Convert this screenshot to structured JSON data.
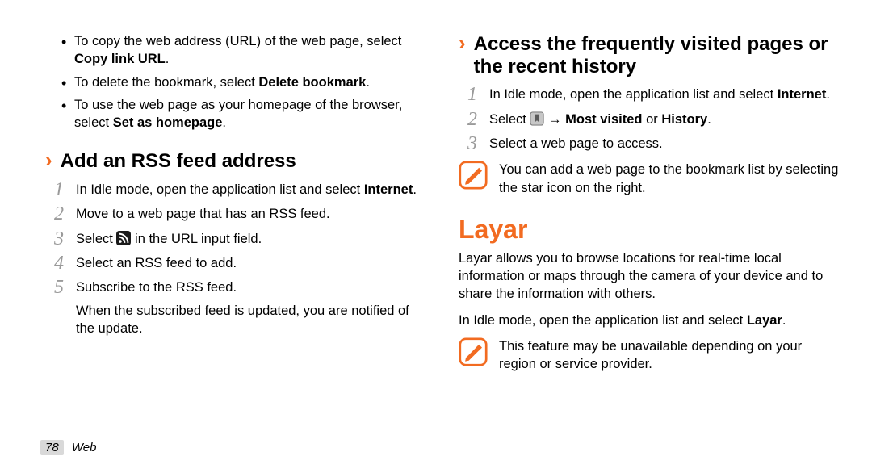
{
  "left": {
    "bullets": [
      {
        "pre": "To copy the web address (URL) of the web page, select ",
        "bold": "Copy link URL",
        "post": "."
      },
      {
        "pre": "To delete the bookmark, select ",
        "bold": "Delete bookmark",
        "post": "."
      },
      {
        "pre": "To use the web page as your homepage of the browser, select ",
        "bold": "Set as homepage",
        "post": "."
      }
    ],
    "section_title": "Add an RSS feed address",
    "steps": {
      "s1": {
        "num": "1",
        "pre": "In Idle mode, open the application list and select ",
        "bold": "Internet",
        "post": "."
      },
      "s2": {
        "num": "2",
        "pre": "Move to a web page that has an RSS feed.",
        "bold": "",
        "post": ""
      },
      "s3": {
        "num": "3",
        "pre": "Select ",
        "post": " in the URL input field."
      },
      "s4": {
        "num": "4",
        "pre": "Select an RSS feed to add.",
        "bold": "",
        "post": ""
      },
      "s5": {
        "num": "5",
        "pre": "Subscribe to the RSS feed.",
        "bold": "",
        "post": ""
      },
      "s5_extra": "When the subscribed feed is updated, you are notified of the update."
    }
  },
  "right": {
    "section_title": "Access the frequently visited pages or the recent history",
    "steps": {
      "s1": {
        "num": "1",
        "pre": "In Idle mode, open the application list and select ",
        "bold": "Internet",
        "post": "."
      },
      "s2": {
        "num": "2",
        "pre": "Select ",
        "mid": " → ",
        "bold": "Most visited",
        "mid2": " or ",
        "bold2": "History",
        "post": "."
      },
      "s3": {
        "num": "3",
        "pre": "Select a web page to access.",
        "bold": "",
        "post": ""
      }
    },
    "note1": "You can add a web page to the bookmark list by selecting the star icon on the right.",
    "big_title": "Layar",
    "big_body1": "Layar allows you to browse locations for real-time local information or maps through the camera of your device and to share the information with others.",
    "big_body2_pre": "In Idle mode, open the application list and select ",
    "big_body2_bold": "Layar",
    "big_body2_post": ".",
    "note2": "This feature may be unavailable depending on your region or service provider."
  },
  "footer": {
    "page": "78",
    "category": "Web"
  }
}
